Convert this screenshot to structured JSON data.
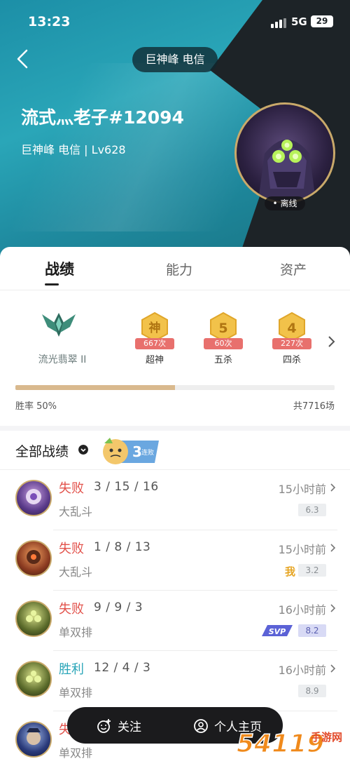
{
  "status_bar": {
    "time": "13:23",
    "network": "5G",
    "battery": "29"
  },
  "header": {
    "server": "巨神峰 电信",
    "player_name": "流式灬老子#12094",
    "player_sub": "巨神峰 电信 | Lv628",
    "avatar_status": "• 离线"
  },
  "tabs": [
    {
      "label": "战绩",
      "active": true
    },
    {
      "label": "能力",
      "active": false
    },
    {
      "label": "资产",
      "active": false
    }
  ],
  "rank": {
    "name": "流光翡翠 II"
  },
  "medals": [
    {
      "glyph": "神",
      "count": "667次",
      "label": "超神"
    },
    {
      "glyph": "5",
      "count": "60次",
      "label": "五杀"
    },
    {
      "glyph": "4",
      "count": "227次",
      "label": "四杀"
    }
  ],
  "summary": {
    "win_rate_text": "胜率 50%",
    "win_rate": 0.5,
    "total": "共7716场"
  },
  "records": {
    "title": "全部战绩",
    "streak_badge": {
      "number": "3",
      "text": "连败"
    },
    "rows": [
      {
        "result": "失败",
        "outcome": "lose",
        "kda": "3 / 15 / 16",
        "mode": "大乱斗",
        "time": "15小时前",
        "score": "6.3",
        "tag": ""
      },
      {
        "result": "失败",
        "outcome": "lose",
        "kda": "1 / 8 / 13",
        "mode": "大乱斗",
        "time": "15小时前",
        "score": "3.2",
        "tag": "我"
      },
      {
        "result": "失败",
        "outcome": "lose",
        "kda": "9 / 9 / 3",
        "mode": "单双排",
        "time": "16小时前",
        "score": "8.2",
        "tag": "SVP"
      },
      {
        "result": "胜利",
        "outcome": "win",
        "kda": "12 / 4 / 3",
        "mode": "单双排",
        "time": "16小时前",
        "score": "8.9",
        "tag": ""
      },
      {
        "result": "失",
        "outcome": "lose",
        "kda": "",
        "mode": "单双排",
        "time": "",
        "score": "",
        "tag": ""
      }
    ]
  },
  "bottom_bar": {
    "follow": "关注",
    "profile": "个人主页"
  },
  "watermark": {
    "text": "54119",
    "sub": "手游网"
  }
}
